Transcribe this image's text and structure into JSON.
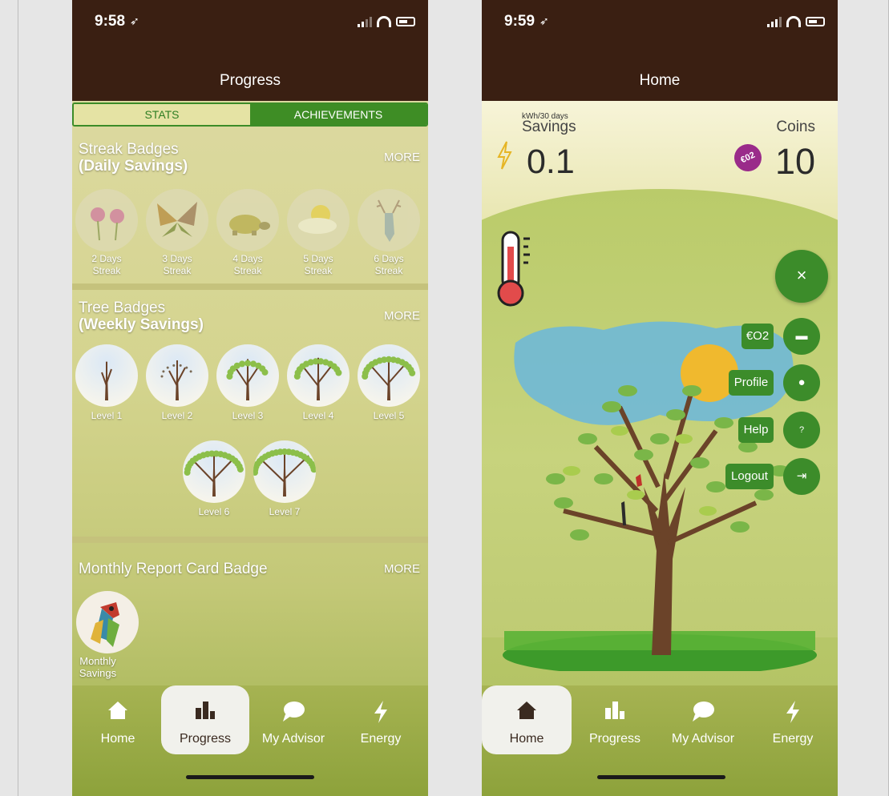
{
  "progress_screen": {
    "status": {
      "time": "9:58"
    },
    "title": "Progress",
    "tabs": [
      {
        "label": "STATS",
        "active": true
      },
      {
        "label": "ACHIEVEMENTS",
        "active": false
      }
    ],
    "streak": {
      "title": "Streak Badges",
      "subtitle": "(Daily Savings)",
      "more": "MORE",
      "badges": [
        {
          "line1": "2 Days",
          "line2": "Streak",
          "icon": "flowers-icon"
        },
        {
          "line1": "3 Days",
          "line2": "Streak",
          "icon": "butterfly-icon"
        },
        {
          "line1": "4 Days",
          "line2": "Streak",
          "icon": "turtle-icon"
        },
        {
          "line1": "5 Days",
          "line2": "Streak",
          "icon": "sun-cloud-icon"
        },
        {
          "line1": "6 Days",
          "line2": "Streak",
          "icon": "deer-icon"
        }
      ]
    },
    "tree": {
      "title": "Tree Badges",
      "subtitle": "(Weekly Savings)",
      "more": "MORE",
      "badges": [
        "Level 1",
        "Level 2",
        "Level 3",
        "Level 4",
        "Level 5",
        "Level 6",
        "Level 7"
      ]
    },
    "monthly": {
      "title": "Monthly Report Card Badge",
      "more": "MORE",
      "badge": {
        "line1": "Monthly",
        "line2": "Savings",
        "icon": "parrot-icon"
      }
    },
    "nav": [
      {
        "label": "Home",
        "icon": "home-icon",
        "active": false
      },
      {
        "label": "Progress",
        "icon": "bar-chart-icon",
        "active": true
      },
      {
        "label": "My Advisor",
        "icon": "chat-bubble-icon",
        "active": false
      },
      {
        "label": "Energy",
        "icon": "lightning-icon",
        "active": false
      }
    ]
  },
  "home_screen": {
    "status": {
      "time": "9:59"
    },
    "title": "Home",
    "savings": {
      "unit": "kWh/30 days",
      "label": "Savings",
      "value": "0.1"
    },
    "coins": {
      "label": "Coins",
      "value": "10",
      "badge": "€02"
    },
    "fab": {
      "close": "×"
    },
    "menu": [
      {
        "label": "€O2",
        "icon": "wallet-icon",
        "symbol": "▬"
      },
      {
        "label": "Profile",
        "icon": "person-icon",
        "symbol": "●"
      },
      {
        "label": "Help",
        "icon": "question-icon",
        "symbol": "?"
      },
      {
        "label": "Logout",
        "icon": "logout-icon",
        "symbol": "⇥"
      }
    ],
    "nav": [
      {
        "label": "Home",
        "icon": "home-icon",
        "active": true
      },
      {
        "label": "Progress",
        "icon": "bar-chart-icon",
        "active": false
      },
      {
        "label": "My Advisor",
        "icon": "chat-bubble-icon",
        "active": false
      },
      {
        "label": "Energy",
        "icon": "lightning-icon",
        "active": false
      }
    ],
    "colors": {
      "accent": "#3c8c2a",
      "header": "#3a1f12"
    }
  }
}
